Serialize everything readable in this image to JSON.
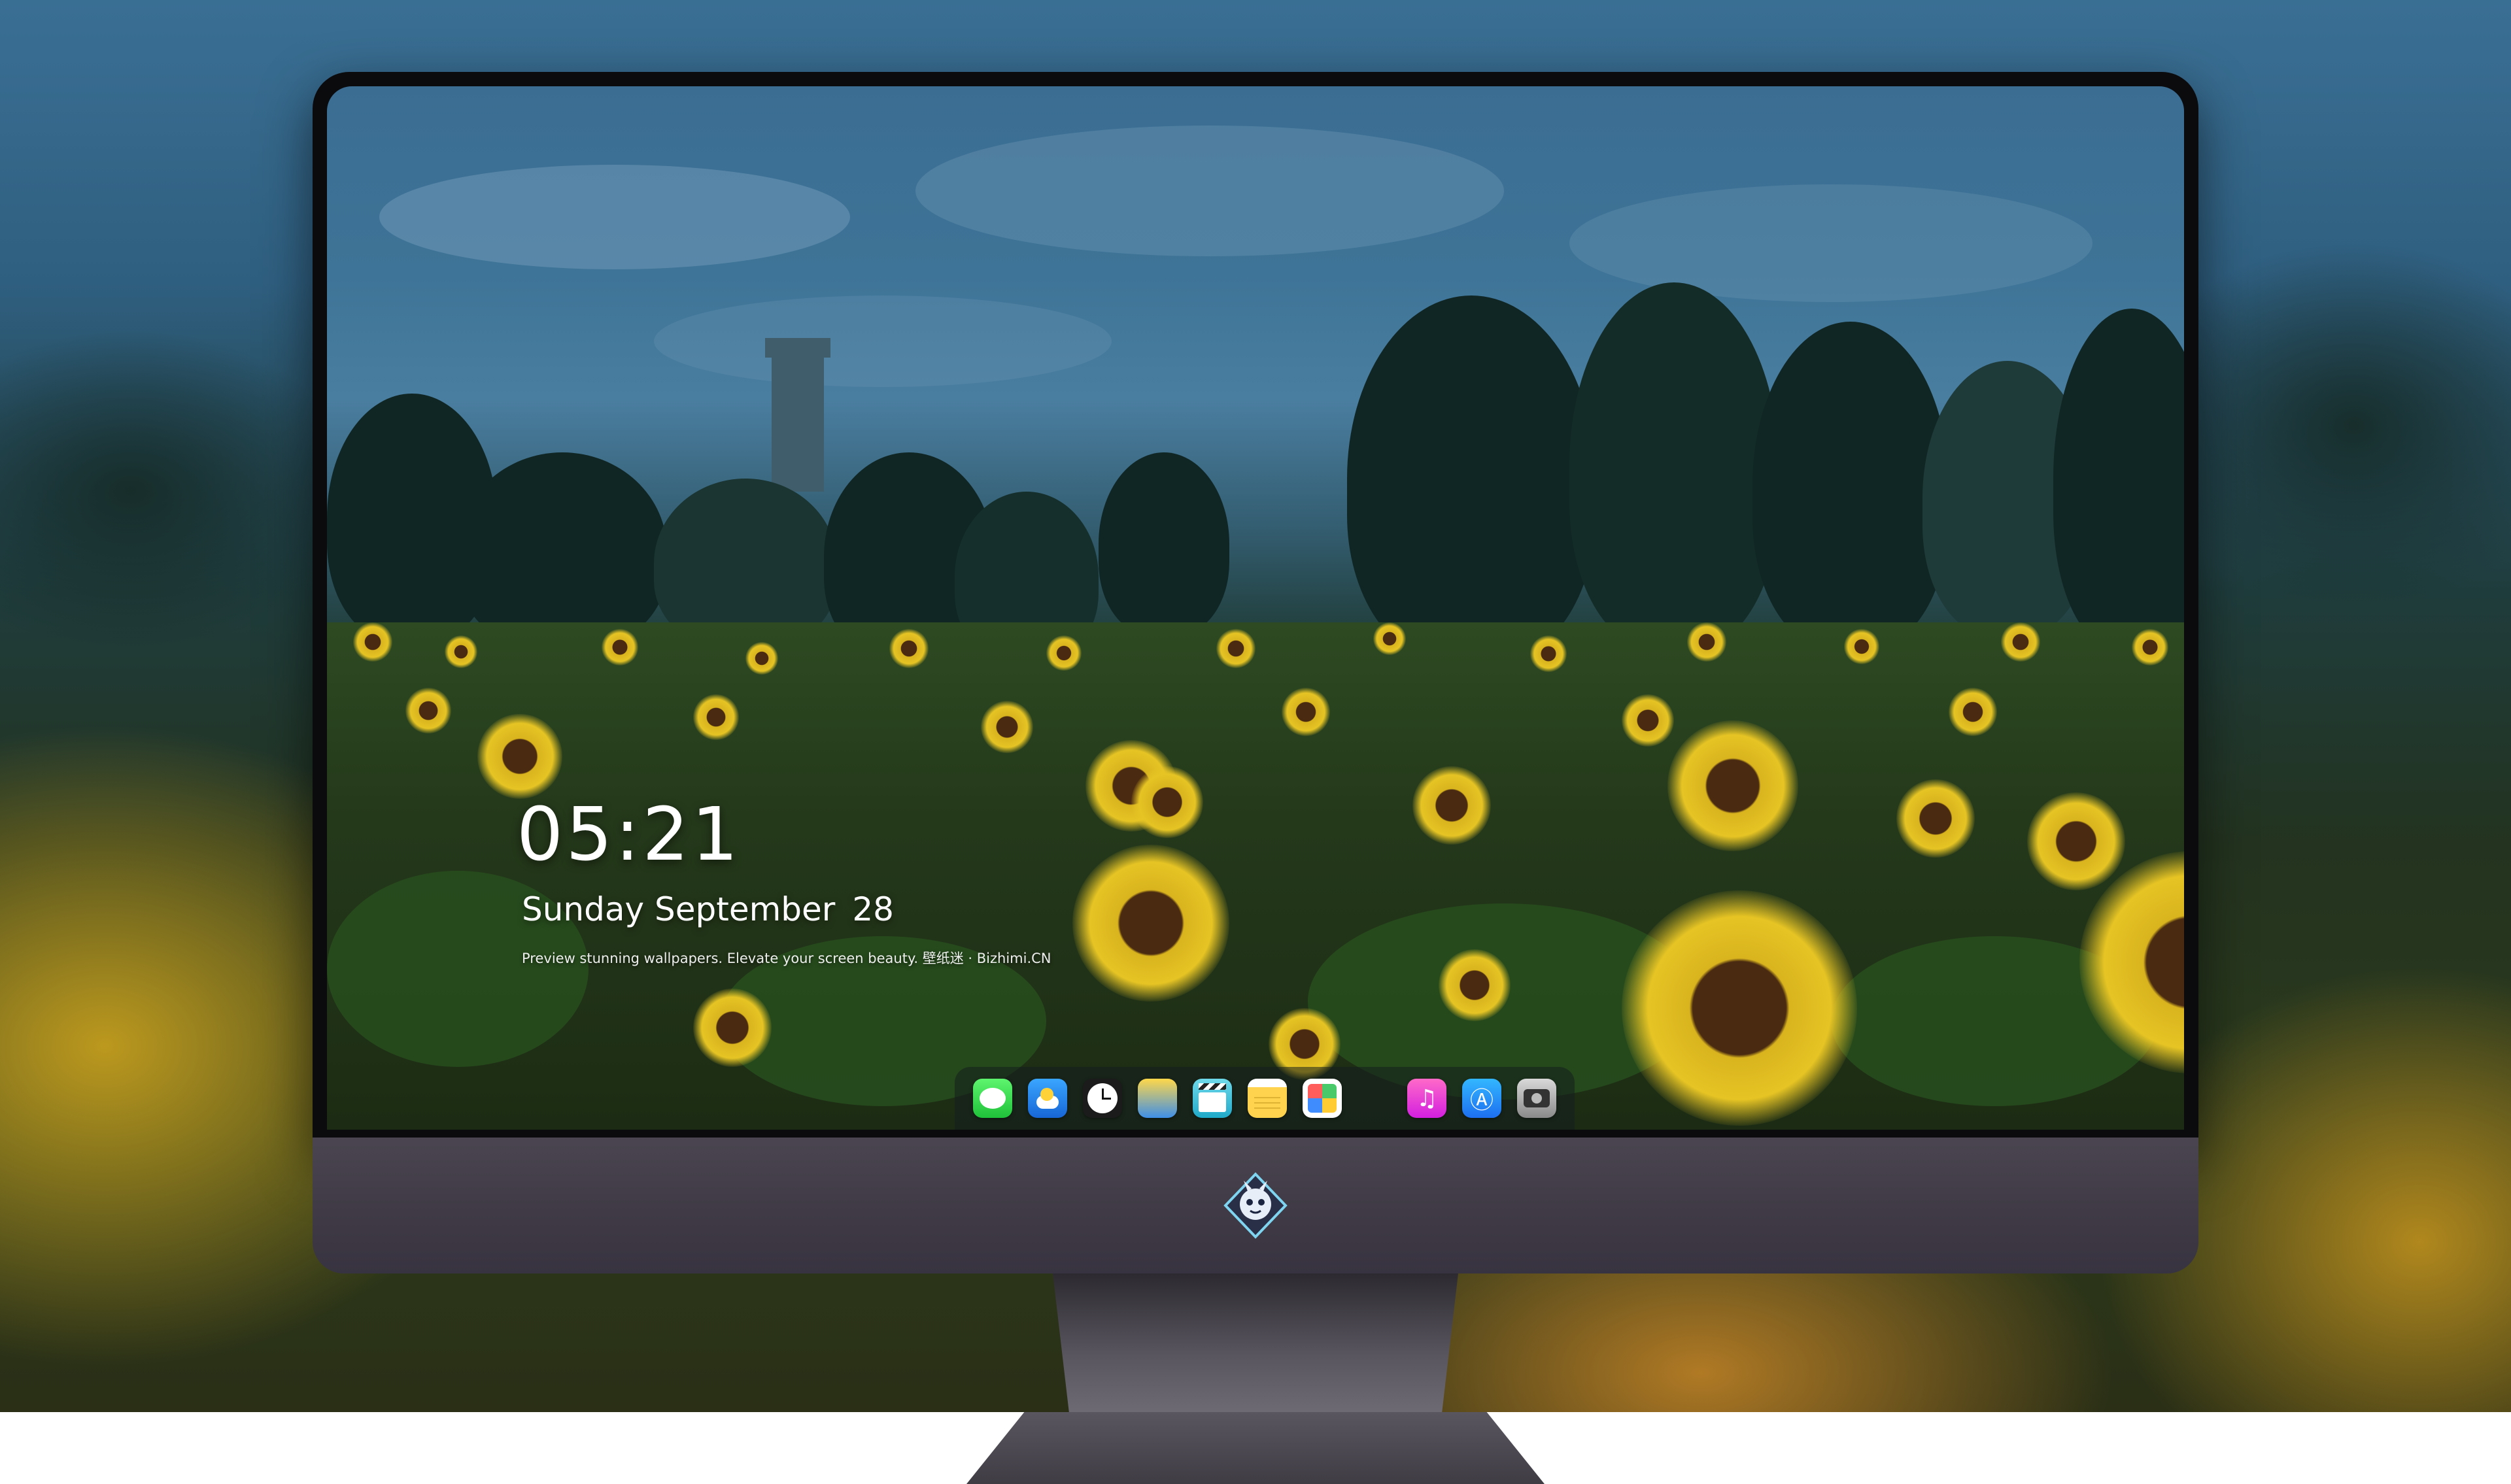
{
  "lockscreen": {
    "time": "05:21",
    "weekday_month": "Sunday September",
    "day": "28",
    "tagline": "Preview stunning wallpapers. Elevate your screen beauty. 壁纸迷 · Bizhimi.CN"
  },
  "dock": {
    "apps": [
      {
        "name": "messages-icon"
      },
      {
        "name": "weather-icon"
      },
      {
        "name": "clock-icon"
      },
      {
        "name": "finder-icon"
      },
      {
        "name": "clips-icon"
      },
      {
        "name": "notes-icon"
      },
      {
        "name": "photos-icon"
      },
      {
        "name": "music-icon"
      },
      {
        "name": "app-store-icon"
      },
      {
        "name": "camera-icon"
      }
    ]
  },
  "monitor": {
    "logo": "dragon-mascot-logo"
  },
  "colors": {
    "bezel": "#0b0b0d",
    "chin": "#403b46",
    "sunflower": "#e6c424",
    "sky": "#3e7497"
  }
}
